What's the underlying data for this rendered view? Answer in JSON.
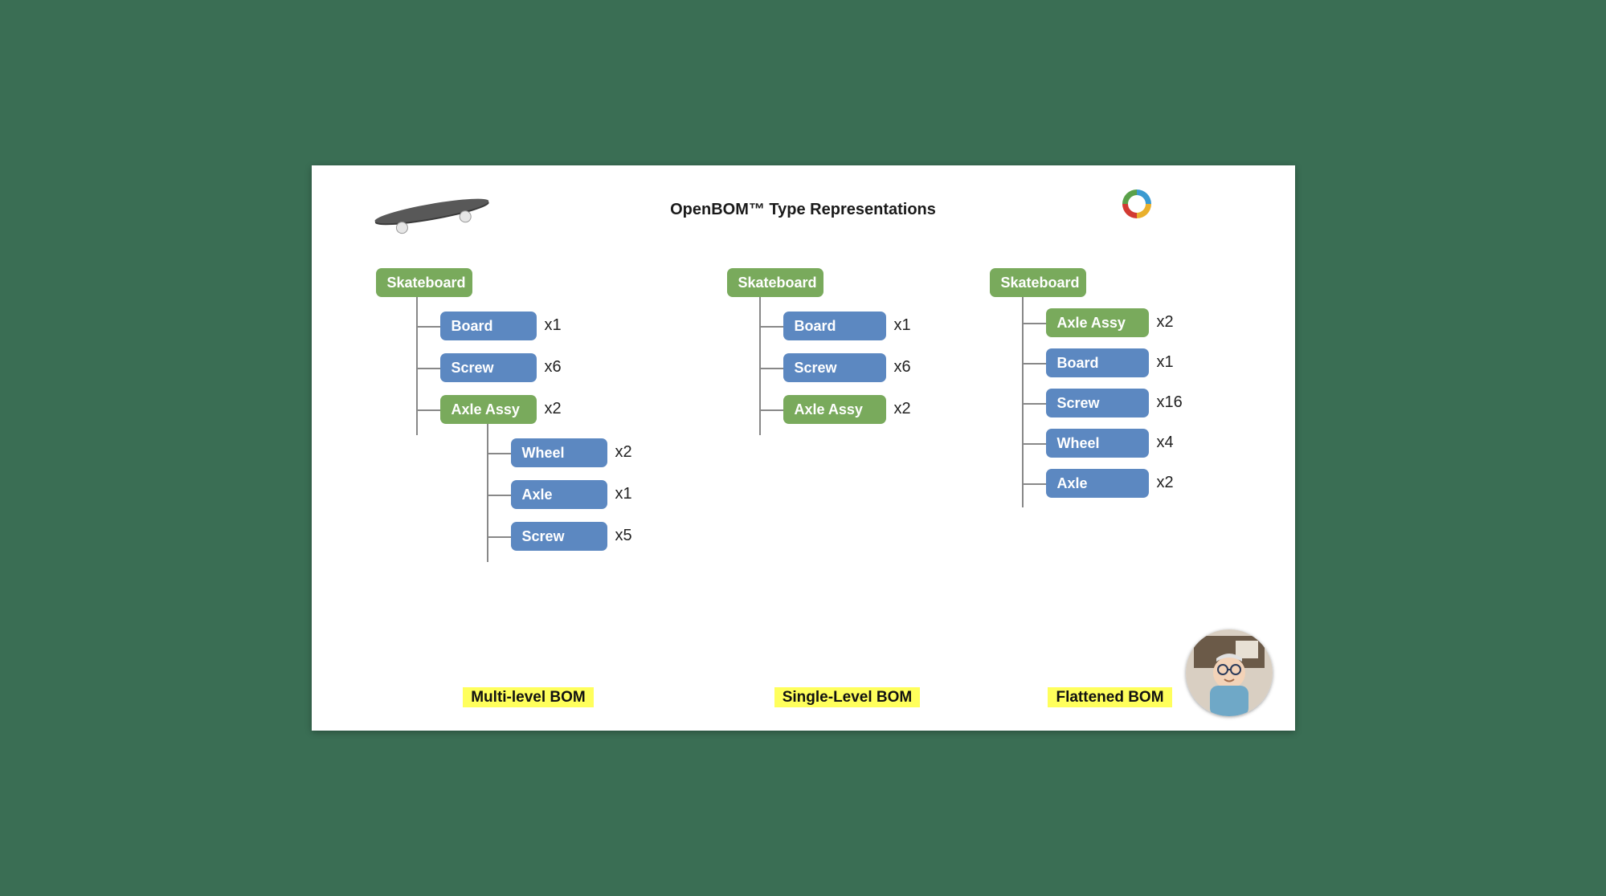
{
  "title": "OpenBOM™ Type Representations",
  "columns": [
    {
      "caption": "Multi-level BOM",
      "root": "Skateboard",
      "level1": [
        {
          "label": "Board",
          "qty": "x1",
          "color": "blue"
        },
        {
          "label": "Screw",
          "qty": "x6",
          "color": "blue"
        },
        {
          "label": "Axle Assy",
          "qty": "x2",
          "color": "green"
        }
      ],
      "level2": [
        {
          "label": "Wheel",
          "qty": "x2",
          "color": "blue"
        },
        {
          "label": "Axle",
          "qty": "x1",
          "color": "blue"
        },
        {
          "label": "Screw",
          "qty": "x5",
          "color": "blue"
        }
      ]
    },
    {
      "caption": "Single-Level BOM",
      "root": "Skateboard",
      "level1": [
        {
          "label": "Board",
          "qty": "x1",
          "color": "blue"
        },
        {
          "label": "Screw",
          "qty": "x6",
          "color": "blue"
        },
        {
          "label": "Axle Assy",
          "qty": "x2",
          "color": "green"
        }
      ]
    },
    {
      "caption": "Flattened BOM",
      "root": "Skateboard",
      "level1": [
        {
          "label": "Axle Assy",
          "qty": "x2",
          "color": "green"
        },
        {
          "label": "Board",
          "qty": "x1",
          "color": "blue"
        },
        {
          "label": "Screw",
          "qty": "x16",
          "color": "blue"
        },
        {
          "label": "Wheel",
          "qty": "x4",
          "color": "blue"
        },
        {
          "label": "Axle",
          "qty": "x2",
          "color": "blue"
        }
      ]
    }
  ]
}
